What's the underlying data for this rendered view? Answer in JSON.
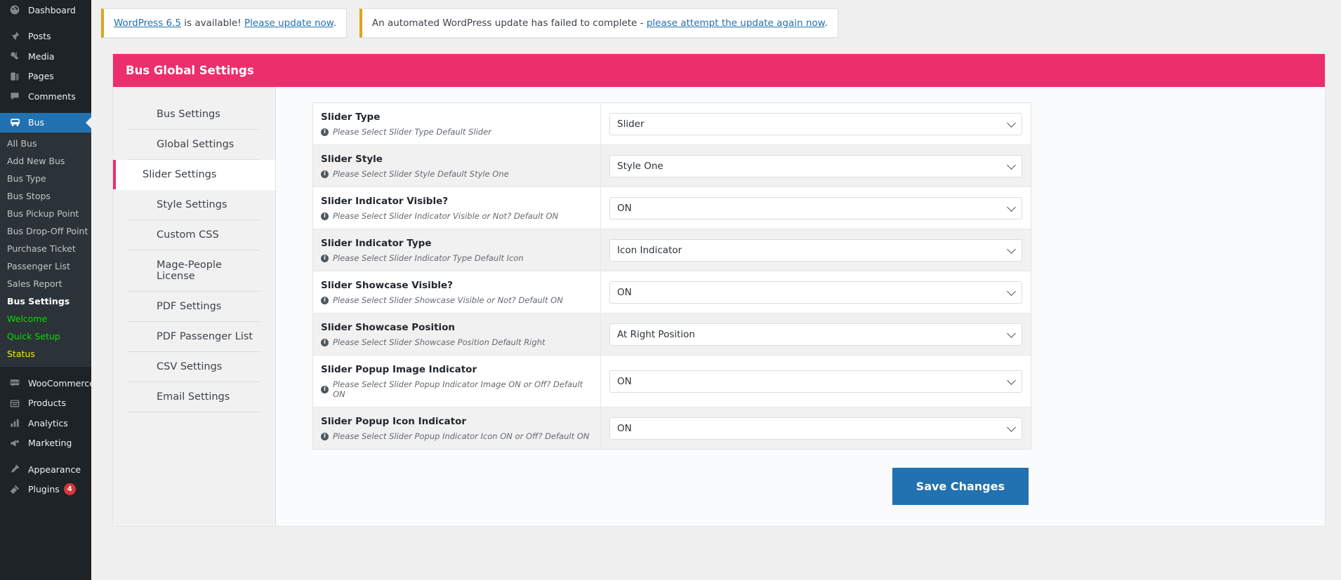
{
  "sidebar": {
    "items": [
      {
        "label": "Dashboard",
        "icon": "dashboard-icon"
      },
      {
        "label": "Posts",
        "icon": "pin-icon"
      },
      {
        "label": "Media",
        "icon": "media-icon"
      },
      {
        "label": "Pages",
        "icon": "pages-icon"
      },
      {
        "label": "Comments",
        "icon": "comments-icon"
      },
      {
        "label": "Bus",
        "icon": "bus-icon"
      },
      {
        "label": "WooCommerce",
        "icon": "woo-icon"
      },
      {
        "label": "Products",
        "icon": "products-icon"
      },
      {
        "label": "Analytics",
        "icon": "analytics-icon"
      },
      {
        "label": "Marketing",
        "icon": "marketing-icon"
      },
      {
        "label": "Appearance",
        "icon": "appearance-icon"
      },
      {
        "label": "Plugins",
        "icon": "plugins-icon",
        "badge": "4"
      }
    ],
    "bus_submenu": [
      {
        "label": "All Bus",
        "state": "normal"
      },
      {
        "label": "Add New Bus",
        "state": "normal"
      },
      {
        "label": "Bus Type",
        "state": "normal"
      },
      {
        "label": "Bus Stops",
        "state": "normal"
      },
      {
        "label": "Bus Pickup Point",
        "state": "normal"
      },
      {
        "label": "Bus Drop-Off Point",
        "state": "normal"
      },
      {
        "label": "Purchase Ticket",
        "state": "normal"
      },
      {
        "label": "Passenger List",
        "state": "normal"
      },
      {
        "label": "Sales Report",
        "state": "normal"
      },
      {
        "label": "Bus Settings",
        "state": "current"
      },
      {
        "label": "Welcome",
        "state": "green"
      },
      {
        "label": "Quick Setup",
        "state": "green"
      },
      {
        "label": "Status",
        "state": "yellow"
      }
    ]
  },
  "notices": [
    {
      "link1": "WordPress 6.5",
      "mid": " is available! ",
      "link2": "Please update now",
      "tail": "."
    },
    {
      "lead": "An automated WordPress update has failed to complete - ",
      "link": "please attempt the update again now",
      "tail": "."
    }
  ],
  "panel": {
    "title": "Bus Global Settings",
    "accent_color": "#ec2e6c",
    "tabs": [
      {
        "label": "Bus Settings",
        "active": false
      },
      {
        "label": "Global Settings",
        "active": false
      },
      {
        "label": "Slider Settings",
        "active": true
      },
      {
        "label": "Style Settings",
        "active": false
      },
      {
        "label": "Custom CSS",
        "active": false
      },
      {
        "label": "Mage-People License",
        "active": false
      },
      {
        "label": "PDF Settings",
        "active": false
      },
      {
        "label": "PDF Passenger List",
        "active": false
      },
      {
        "label": "CSV Settings",
        "active": false
      },
      {
        "label": "Email Settings",
        "active": false
      }
    ],
    "settings": [
      {
        "label": "Slider Type",
        "description": "Please Select Slider Type Default Slider",
        "value": "Slider"
      },
      {
        "label": "Slider Style",
        "description": "Please Select Slider Style Default Style One",
        "value": "Style One"
      },
      {
        "label": "Slider Indicator Visible?",
        "description": "Please Select Slider Indicator Visible or Not? Default ON",
        "value": "ON"
      },
      {
        "label": "Slider Indicator Type",
        "description": "Please Select Slider Indicator Type Default Icon",
        "value": "Icon Indicator"
      },
      {
        "label": "Slider Showcase Visible?",
        "description": "Please Select Slider Showcase Visible or Not? Default ON",
        "value": "ON"
      },
      {
        "label": "Slider Showcase Position",
        "description": "Please Select Slider Showcase Position Default Right",
        "value": "At Right Position"
      },
      {
        "label": "Slider Popup Image Indicator",
        "description": "Please Select Slider Popup Indicator Image ON or Off? Default ON",
        "value": "ON"
      },
      {
        "label": "Slider Popup Icon Indicator",
        "description": "Please Select Slider Popup Indicator Icon ON or Off? Default ON",
        "value": "ON"
      }
    ],
    "save_label": "Save Changes",
    "save_color": "#2271b1"
  }
}
